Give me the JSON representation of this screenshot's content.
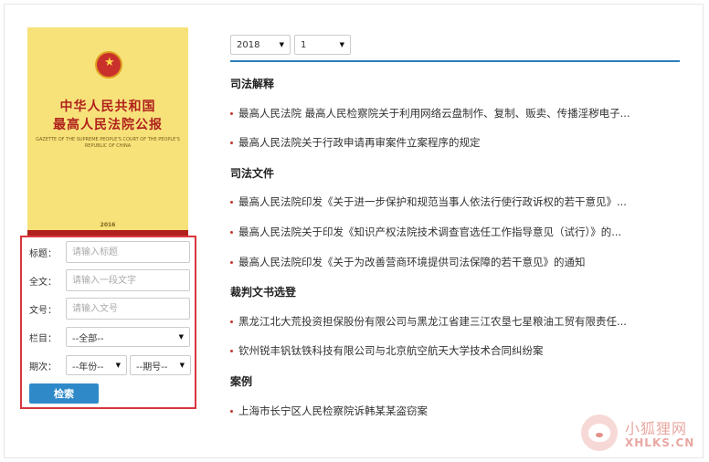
{
  "cover": {
    "title_line1": "中华人民共和国",
    "title_line2": "最高人民法院公报",
    "subtitle": "GAZETTE OF THE SUPREME PEOPLE'S COURT OF THE PEOPLE'S REPUBLIC OF CHINA",
    "year": "2016"
  },
  "search": {
    "title_label": "标题：",
    "title_placeholder": "请输入标题",
    "fulltext_label": "全文：",
    "fulltext_placeholder": "请输入一段文字",
    "docno_label": "文号：",
    "docno_placeholder": "请输入文号",
    "column_label": "栏目：",
    "column_value": "--全部--",
    "issue_label": "期次：",
    "year_value": "--年份--",
    "period_value": "--期号--",
    "button_label": "检索"
  },
  "filters": {
    "year": "2018",
    "issue": "1"
  },
  "sections": [
    {
      "title": "司法解释",
      "items": [
        "最高人民法院 最高人民检察院关于利用网络云盘制作、复制、贩卖、传播淫秽电子...",
        "最高人民法院关于行政申请再审案件立案程序的规定"
      ]
    },
    {
      "title": "司法文件",
      "items": [
        "最高人民法院印发《关于进一步保护和规范当事人依法行使行政诉权的若干意见》...",
        "最高人民法院关于印发《知识产权法院技术调查官选任工作指导意见（试行）》的...",
        "最高人民法院印发《关于为改善营商环境提供司法保障的若干意见》的通知"
      ]
    },
    {
      "title": "裁判文书选登",
      "items": [
        "黑龙江北大荒投资担保股份有限公司与黑龙江省建三江农垦七星粮油工贸有限责任...",
        "钦州锐丰钒钛铁科技有限公司与北京航空航天大学技术合同纠纷案"
      ]
    },
    {
      "title": "案例",
      "items": [
        "上海市长宁区人民检察院诉韩某某盗窃案"
      ]
    }
  ],
  "watermark": {
    "cn": "小狐狸网",
    "en": "XHLKS.CN"
  },
  "colors": {
    "accent_blue": "#2a7fb8",
    "button_blue": "#2f89c9",
    "highlight_red": "#d9363e",
    "bullet_red": "#c0392b"
  }
}
